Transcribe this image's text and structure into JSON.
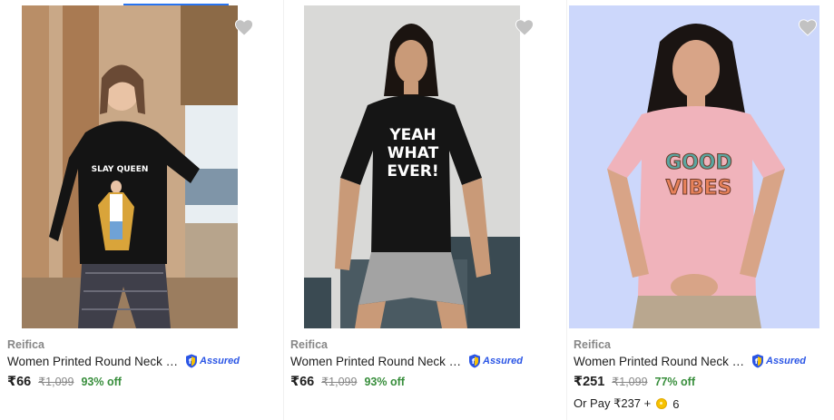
{
  "products": [
    {
      "brand": "Reifica",
      "title": "Women Printed Round Neck Pur...",
      "assured_label": "Assured",
      "price": "₹66",
      "mrp": "₹1,099",
      "discount": "93% off",
      "print_text": "SLAY QUEEN",
      "image_colors": {
        "background": "#c9a887",
        "shirt": "#141414"
      }
    },
    {
      "brand": "Reifica",
      "title": "Women Printed Round Neck Pur...",
      "assured_label": "Assured",
      "price": "₹66",
      "mrp": "₹1,099",
      "discount": "93% off",
      "print_text_lines": [
        "YEAH",
        "WHAT",
        "EVER!"
      ],
      "image_colors": {
        "background": "#d9d9d7",
        "shirt": "#151515"
      }
    },
    {
      "brand": "Reifica",
      "title": "Women Printed Round Neck Pur...",
      "assured_label": "Assured",
      "price": "₹251",
      "mrp": "₹1,099",
      "discount": "77% off",
      "pay_prefix": "Or Pay ₹237 +",
      "coin_count": "6",
      "print_text_lines": [
        "GOOD",
        "VIBES"
      ],
      "image_colors": {
        "background": "#ccd7fb",
        "shirt": "#f0b3bb"
      }
    }
  ],
  "colors": {
    "accent": "#2874f0",
    "discount": "#388e3c",
    "assured": "#2a55e5",
    "wishlist": "#c2c2c2"
  },
  "icons": [
    "heart-icon",
    "assured-badge-icon",
    "supercoin-icon"
  ]
}
